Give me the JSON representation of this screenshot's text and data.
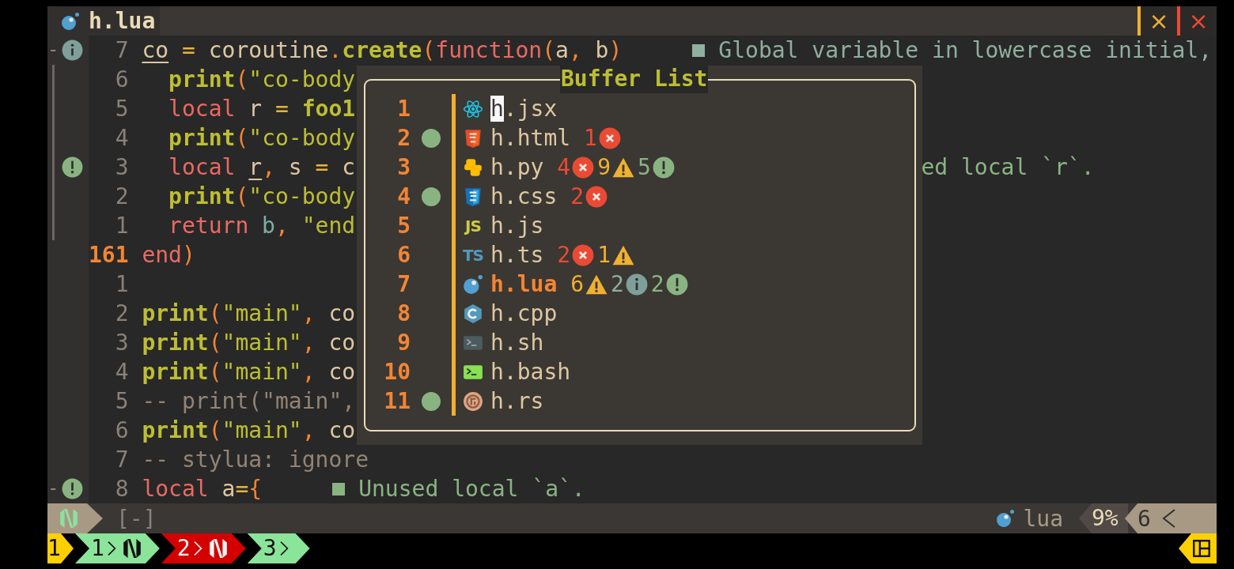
{
  "tabline": {
    "tabs": [
      {
        "name": "h.lua",
        "kind": "lua",
        "selected": true
      }
    ],
    "buttons": [
      {
        "kind": "buffer-close",
        "label": "×"
      },
      {
        "kind": "tab-close",
        "label": "×"
      }
    ]
  },
  "editor": {
    "lines": [
      {
        "number": "7",
        "current": false,
        "guide": false,
        "sign": {
          "fold": "-",
          "kind": "info"
        },
        "segments": [
          {
            "t": "co",
            "kind": "unused"
          },
          {
            "t": " =",
            "kind": "op"
          },
          {
            "t": " coroutine",
            "kind": "plain"
          },
          {
            "t": ".",
            "kind": "paren"
          },
          {
            "t": "create",
            "kind": "fn"
          },
          {
            "t": "(",
            "kind": "paren"
          },
          {
            "t": "function",
            "kind": "kw"
          },
          {
            "t": "(",
            "kind": "paren"
          },
          {
            "t": "a",
            "kind": "plain"
          },
          {
            "t": ",",
            "kind": "paren"
          },
          {
            "t": " b",
            "kind": "plain"
          },
          {
            "t": ")",
            "kind": "paren"
          }
        ],
        "diagnostic": {
          "kind": "info",
          "text": "Global variable in lowercase initial,"
        }
      },
      {
        "number": "6",
        "current": false,
        "guide": true,
        "segments": [
          {
            "t": "  print",
            "kind": "fn"
          },
          {
            "t": "(",
            "kind": "paren"
          },
          {
            "t": "\"co-body",
            "kind": "str"
          }
        ]
      },
      {
        "number": "5",
        "current": false,
        "guide": true,
        "segments": [
          {
            "t": "  local",
            "kind": "kw"
          },
          {
            "t": " r",
            "kind": "plain"
          },
          {
            "t": " =",
            "kind": "op"
          },
          {
            "t": " foo1",
            "kind": "fn"
          }
        ]
      },
      {
        "number": "4",
        "current": false,
        "guide": true,
        "segments": [
          {
            "t": "  print",
            "kind": "fn"
          },
          {
            "t": "(",
            "kind": "paren"
          },
          {
            "t": "\"co-body",
            "kind": "str"
          }
        ]
      },
      {
        "number": "3",
        "current": false,
        "guide": true,
        "sign": {
          "kind": "hint"
        },
        "segments": [
          {
            "t": "  local ",
            "kind": "kw"
          },
          {
            "t": "r",
            "kind": "unused"
          },
          {
            "t": ",",
            "kind": "paren"
          },
          {
            "t": " s",
            "kind": "plain"
          },
          {
            "t": " =",
            "kind": "op"
          },
          {
            "t": " c",
            "kind": "plain"
          }
        ],
        "diagnostic_tail": {
          "kind": "hint",
          "text": "ed local `r`."
        }
      },
      {
        "number": "2",
        "current": false,
        "guide": true,
        "segments": [
          {
            "t": "  print",
            "kind": "fn"
          },
          {
            "t": "(",
            "kind": "paren"
          },
          {
            "t": "\"co-body",
            "kind": "str"
          }
        ]
      },
      {
        "number": "1",
        "current": false,
        "guide": true,
        "segments": [
          {
            "t": "  return",
            "kind": "kw"
          },
          {
            "t": " b",
            "kind": "var"
          },
          {
            "t": ",",
            "kind": "paren"
          },
          {
            "t": " \"end",
            "kind": "str"
          }
        ]
      },
      {
        "number": "161",
        "current": true,
        "guide": false,
        "segments": [
          {
            "t": "end",
            "kind": "kw"
          },
          {
            "t": ")",
            "kind": "paren"
          }
        ]
      },
      {
        "number": "1",
        "current": false,
        "guide": false
      },
      {
        "number": "2",
        "current": false,
        "guide": false,
        "segments": [
          {
            "t": "print",
            "kind": "fn"
          },
          {
            "t": "(",
            "kind": "paren"
          },
          {
            "t": "\"main\"",
            "kind": "str"
          },
          {
            "t": ",",
            "kind": "paren"
          },
          {
            "t": " co",
            "kind": "plain"
          }
        ]
      },
      {
        "number": "3",
        "current": false,
        "guide": false,
        "segments": [
          {
            "t": "print",
            "kind": "fn"
          },
          {
            "t": "(",
            "kind": "paren"
          },
          {
            "t": "\"main\"",
            "kind": "str"
          },
          {
            "t": ",",
            "kind": "paren"
          },
          {
            "t": " co",
            "kind": "plain"
          }
        ]
      },
      {
        "number": "4",
        "current": false,
        "guide": false,
        "segments": [
          {
            "t": "print",
            "kind": "fn"
          },
          {
            "t": "(",
            "kind": "paren"
          },
          {
            "t": "\"main\"",
            "kind": "str"
          },
          {
            "t": ",",
            "kind": "paren"
          },
          {
            "t": " co",
            "kind": "plain"
          }
        ]
      },
      {
        "number": "5",
        "current": false,
        "guide": false,
        "segments": [
          {
            "t": "-- print(\"main\",",
            "kind": "comment"
          }
        ]
      },
      {
        "number": "6",
        "current": false,
        "guide": false,
        "segments": [
          {
            "t": "print",
            "kind": "fn"
          },
          {
            "t": "(",
            "kind": "paren"
          },
          {
            "t": "\"main\"",
            "kind": "str"
          },
          {
            "t": ",",
            "kind": "paren"
          },
          {
            "t": " co",
            "kind": "plain"
          }
        ]
      },
      {
        "number": "7",
        "current": false,
        "guide": false,
        "segments": [
          {
            "t": "-- stylua: ignore",
            "kind": "comment"
          }
        ]
      },
      {
        "number": "8",
        "current": false,
        "guide": false,
        "sign": {
          "fold": "-",
          "kind": "hint"
        },
        "segments": [
          {
            "t": "local",
            "kind": "kw"
          },
          {
            "t": " a",
            "kind": "plain"
          },
          {
            "t": "=",
            "kind": "op"
          },
          {
            "t": "{",
            "kind": "paren"
          }
        ],
        "diagnostic": {
          "kind": "hint",
          "text": "Unused local `a`."
        }
      }
    ]
  },
  "buffer_list": {
    "title": "Buffer List",
    "buffers": [
      {
        "number": "1",
        "modified": false,
        "kind": "jsx",
        "name": "h.jsx",
        "current": false,
        "cursor": true
      },
      {
        "number": "2",
        "modified": true,
        "kind": "html",
        "name": "h.html",
        "current": false,
        "cursor": false,
        "diagnostics": [
          {
            "kind": "error",
            "count": "1"
          }
        ]
      },
      {
        "number": "3",
        "modified": false,
        "kind": "python",
        "name": "h.py",
        "current": false,
        "cursor": false,
        "diagnostics": [
          {
            "kind": "error",
            "count": "4"
          },
          {
            "kind": "warn",
            "count": "9"
          },
          {
            "kind": "hint",
            "count": "5"
          }
        ]
      },
      {
        "number": "4",
        "modified": true,
        "kind": "css",
        "name": "h.css",
        "current": false,
        "cursor": false,
        "diagnostics": [
          {
            "kind": "error",
            "count": "2"
          }
        ]
      },
      {
        "number": "5",
        "modified": false,
        "kind": "js",
        "badge": "JS",
        "name": "h.js",
        "current": false,
        "cursor": false
      },
      {
        "number": "6",
        "modified": false,
        "kind": "ts",
        "badge": "TS",
        "name": "h.ts",
        "current": false,
        "cursor": false,
        "diagnostics": [
          {
            "kind": "error",
            "count": "2"
          },
          {
            "kind": "warn",
            "count": "1"
          }
        ]
      },
      {
        "number": "7",
        "modified": false,
        "kind": "lua",
        "name": "h.lua",
        "current": true,
        "cursor": false,
        "diagnostics": [
          {
            "kind": "warn",
            "count": "6"
          },
          {
            "kind": "info",
            "count": "2"
          },
          {
            "kind": "hint",
            "count": "2"
          }
        ]
      },
      {
        "number": "8",
        "modified": false,
        "kind": "cpp",
        "name": "h.cpp",
        "current": false,
        "cursor": false
      },
      {
        "number": "9",
        "modified": false,
        "kind": "sh",
        "name": "h.sh",
        "current": false,
        "cursor": false
      },
      {
        "number": "10",
        "modified": false,
        "kind": "bash",
        "name": "h.bash",
        "current": false,
        "cursor": false
      },
      {
        "number": "11",
        "modified": true,
        "kind": "rust",
        "name": "h.rs",
        "current": false,
        "cursor": false
      }
    ]
  },
  "statusline": {
    "mode": {
      "kind": "normal"
    },
    "buffer_flag": "[-]",
    "filetype": {
      "kind": "lua",
      "name": "lua"
    },
    "progress": "9%",
    "line": "6"
  },
  "tmux": {
    "session": "1",
    "windows": [
      {
        "index": "1",
        "kind": "neovim",
        "selected": false
      },
      {
        "index": "2",
        "kind": "neovim",
        "selected": true
      },
      {
        "index": "3",
        "kind": "plain",
        "selected": false
      }
    ]
  }
}
